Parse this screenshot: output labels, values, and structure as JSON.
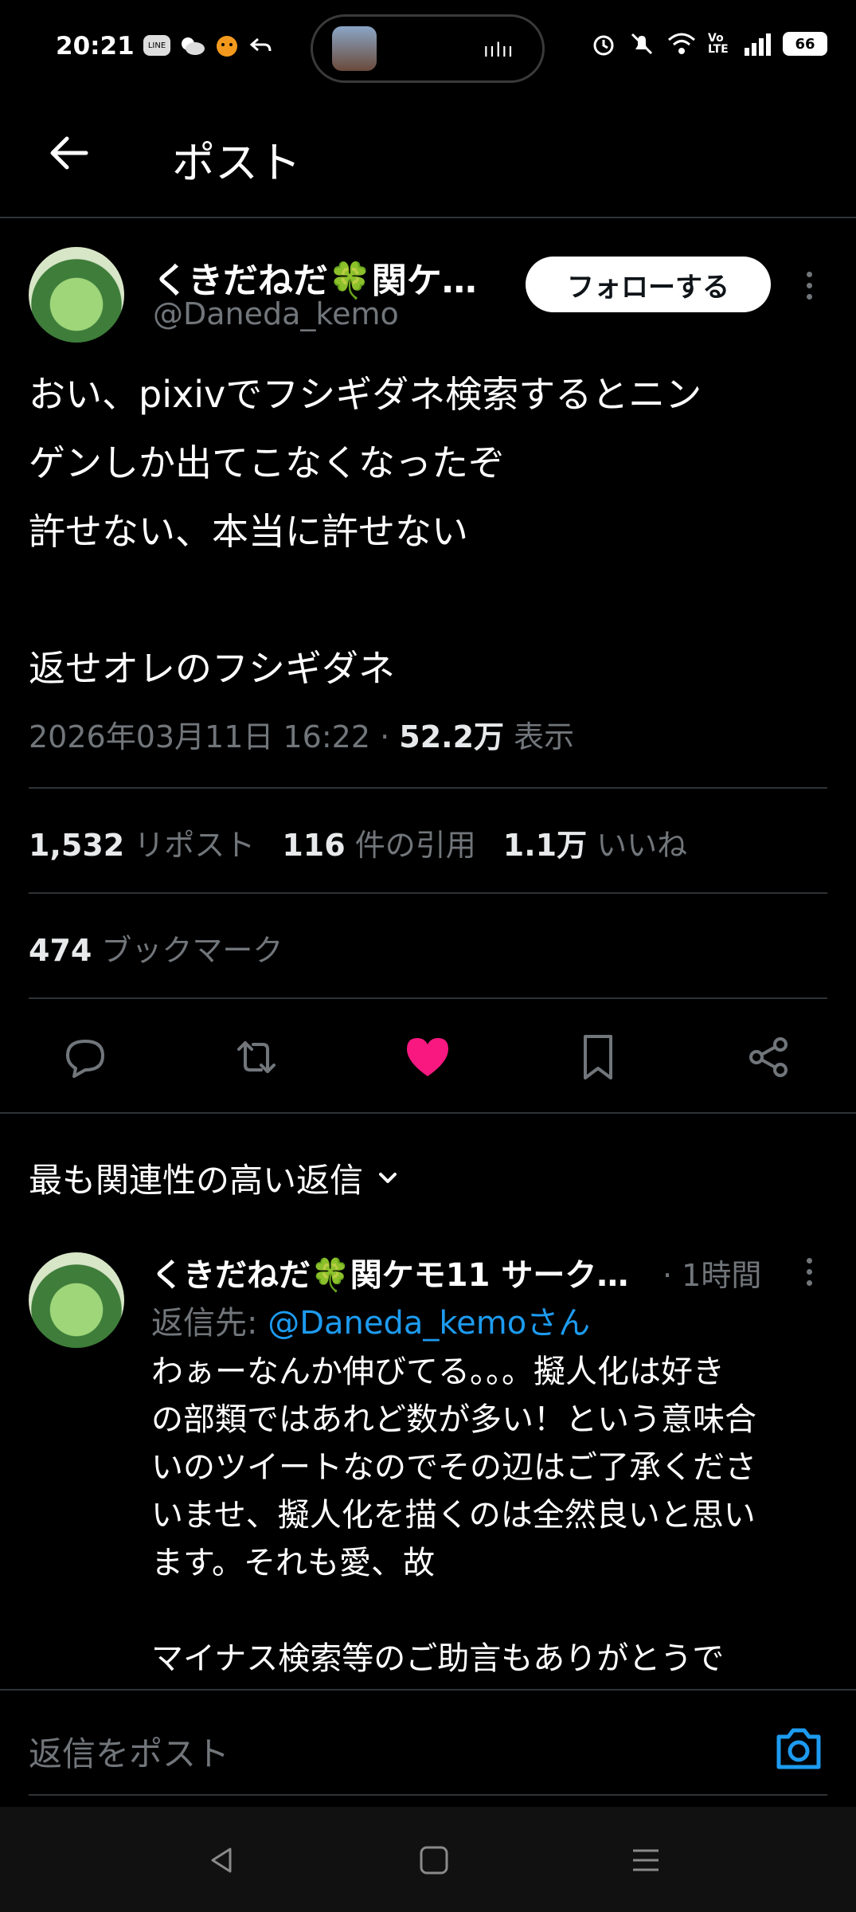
{
  "status_bar": {
    "time": "20:21",
    "left_icons": [
      "line-icon",
      "weather-icon",
      "app-icon",
      "reply-arrow-icon"
    ],
    "island_wave": "ıılıı",
    "right_icons": [
      "alarm-icon",
      "mute-icon",
      "wifi-icon",
      "volte-icon",
      "signal-icon"
    ],
    "volte": "Vo LTE",
    "battery": "66"
  },
  "header": {
    "title": "ポスト"
  },
  "post": {
    "author_name": "くきだねだ🍀関ケ…",
    "author_handle": "@Daneda_kemo",
    "follow_label": "フォローする",
    "text": "おい、pixivでフシギダネ検索するとニン\nゲンしか出てこなくなったぞ\n許せない、本当に許せない\n\n返せオレのフシギダネ",
    "datetime": "2026年03月11日 16:22",
    "separator": "·",
    "views_count": "52.2万",
    "views_label": "表示",
    "reposts_count": "1,532",
    "reposts_label": "リポスト",
    "quotes_count": "116",
    "quotes_label": "件の引用",
    "likes_count": "1.1万",
    "likes_label": "いいね",
    "bookmarks_count": "474",
    "bookmarks_label": "ブックマーク"
  },
  "actions": [
    "reply-icon",
    "repost-icon",
    "like-icon",
    "bookmark-icon",
    "share-icon"
  ],
  "colors": {
    "accent": "#1d9bf0",
    "like": "#f91880",
    "muted": "#71767b",
    "divider": "#2f3336"
  },
  "replies_section": {
    "sort_label": "最も関連性の高い返信"
  },
  "reply": {
    "author_name": "くきだねだ🍀関ケモ11 サーク…",
    "time": "· 1時間",
    "reply_to_prefix": "返信先: ",
    "reply_to_mention": "@Daneda_kemoさん",
    "text": "わぁーなんか伸びてる。。。擬人化は好き\nの部類ではあれど数が多い！という意味合\nいのツイートなのでその辺はご了承くださ\nいませ、擬人化を描くのは全然良いと思い\nます。それも愛、故\n\nマイナス検索等のご助言もありがとうで"
  },
  "composer": {
    "placeholder": "返信をポスト"
  },
  "navbar": [
    "back-nav-icon",
    "home-nav-icon",
    "recents-nav-icon"
  ]
}
